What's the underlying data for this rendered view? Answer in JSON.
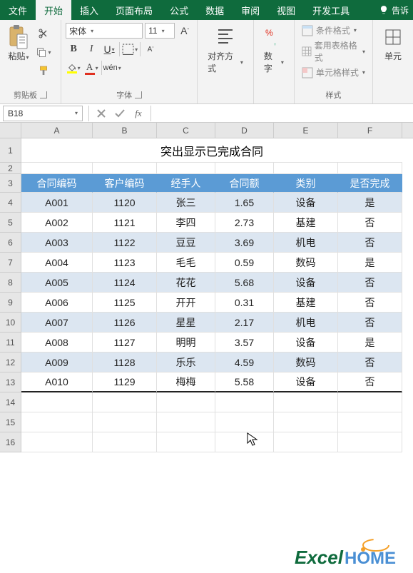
{
  "menu": {
    "tabs": [
      "文件",
      "开始",
      "插入",
      "页面布局",
      "公式",
      "数据",
      "审阅",
      "视图",
      "开发工具"
    ],
    "active": 1,
    "tell": "告诉"
  },
  "ribbon": {
    "clipboard": {
      "paste": "粘贴",
      "label": "剪贴板"
    },
    "font": {
      "name": "宋体",
      "size": "11",
      "label": "字体",
      "aa_inc": "A",
      "aa_dec": "A",
      "b": "B",
      "i": "I",
      "u": "U",
      "a_font": "A",
      "wen": "wén"
    },
    "align": {
      "label": "对齐方式"
    },
    "number": {
      "label": "数字"
    },
    "styles": {
      "cond": "条件格式",
      "table": "套用表格格式",
      "cell": "单元格样式",
      "label": "样式"
    },
    "cells": {
      "label": "单元"
    }
  },
  "fbar": {
    "name": "B18",
    "fx": "fx"
  },
  "sheet": {
    "cols": [
      "A",
      "B",
      "C",
      "D",
      "E",
      "F"
    ],
    "title": "突出显示已完成合同",
    "headers": [
      "合同编码",
      "客户编码",
      "经手人",
      "合同额",
      "类别",
      "是否完成"
    ],
    "rows": [
      [
        "A001",
        "1120",
        "张三",
        "1.65",
        "设备",
        "是"
      ],
      [
        "A002",
        "1121",
        "李四",
        "2.73",
        "基建",
        "否"
      ],
      [
        "A003",
        "1122",
        "豆豆",
        "3.69",
        "机电",
        "否"
      ],
      [
        "A004",
        "1123",
        "毛毛",
        "0.59",
        "数码",
        "是"
      ],
      [
        "A005",
        "1124",
        "花花",
        "5.68",
        "设备",
        "否"
      ],
      [
        "A006",
        "1125",
        "开开",
        "0.31",
        "基建",
        "否"
      ],
      [
        "A007",
        "1126",
        "星星",
        "2.17",
        "机电",
        "否"
      ],
      [
        "A008",
        "1127",
        "明明",
        "3.57",
        "设备",
        "是"
      ],
      [
        "A009",
        "1128",
        "乐乐",
        "4.59",
        "数码",
        "否"
      ],
      [
        "A010",
        "1129",
        "梅梅",
        "5.58",
        "设备",
        "否"
      ]
    ],
    "rownums": [
      "1",
      "2",
      "3",
      "4",
      "5",
      "6",
      "7",
      "8",
      "9",
      "10",
      "11",
      "12",
      "13",
      "14",
      "15",
      "16"
    ]
  },
  "logo": {
    "text1": "Excel",
    "text2": "HOME"
  }
}
